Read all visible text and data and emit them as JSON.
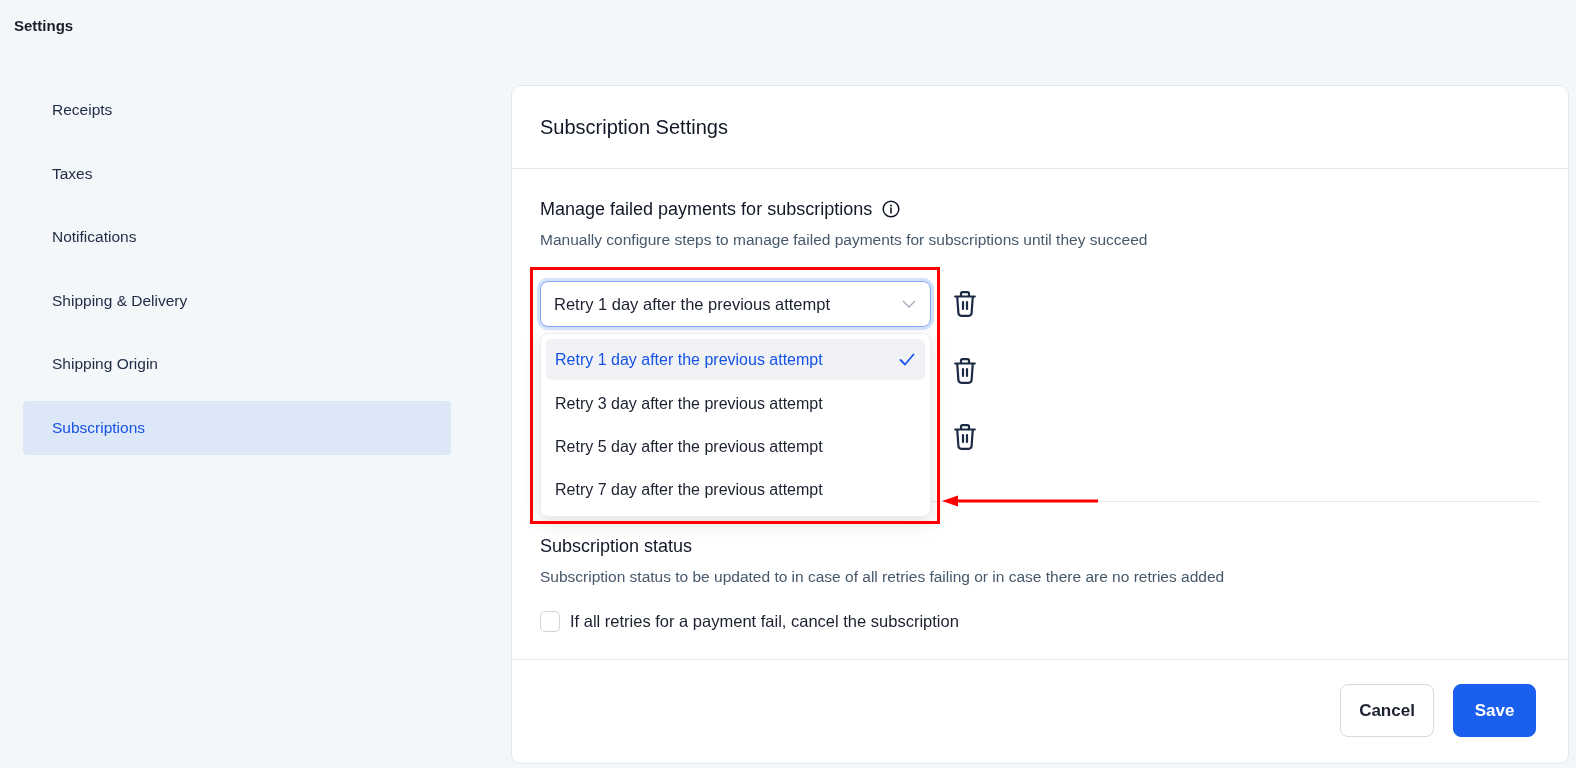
{
  "header": {
    "title": "Settings"
  },
  "sidebar": {
    "items": [
      {
        "label": "Receipts",
        "selected": false
      },
      {
        "label": "Taxes",
        "selected": false
      },
      {
        "label": "Notifications",
        "selected": false
      },
      {
        "label": "Shipping & Delivery",
        "selected": false
      },
      {
        "label": "Shipping Origin",
        "selected": false
      },
      {
        "label": "Subscriptions",
        "selected": true
      }
    ]
  },
  "card": {
    "title": "Subscription Settings",
    "failed_payments": {
      "title": "Manage failed payments for subscriptions",
      "description": "Manually configure steps to manage failed payments for subscriptions until they succeed",
      "steps": [
        {
          "kind": "select",
          "value": "Retry 1 day after the previous attempt",
          "expanded": true,
          "options": [
            {
              "label": "Retry 1 day after the previous attempt",
              "selected": true
            },
            {
              "label": "Retry 3 day after the previous attempt",
              "selected": false
            },
            {
              "label": "Retry 5 day after the previous attempt",
              "selected": false
            },
            {
              "label": "Retry 7 day after the previous attempt",
              "selected": false
            }
          ]
        },
        {
          "kind": "covered"
        },
        {
          "kind": "covered"
        }
      ]
    },
    "subscription_status": {
      "title": "Subscription status",
      "description": "Subscription status to be updated to in case of all retries failing or in case there are no retries added",
      "checkbox": {
        "label": "If all retries for a payment fail, cancel the subscription",
        "checked": false
      }
    },
    "buttons": [
      {
        "label": "Cancel",
        "kind": "secondary"
      },
      {
        "label": "Save",
        "kind": "primary"
      }
    ]
  }
}
